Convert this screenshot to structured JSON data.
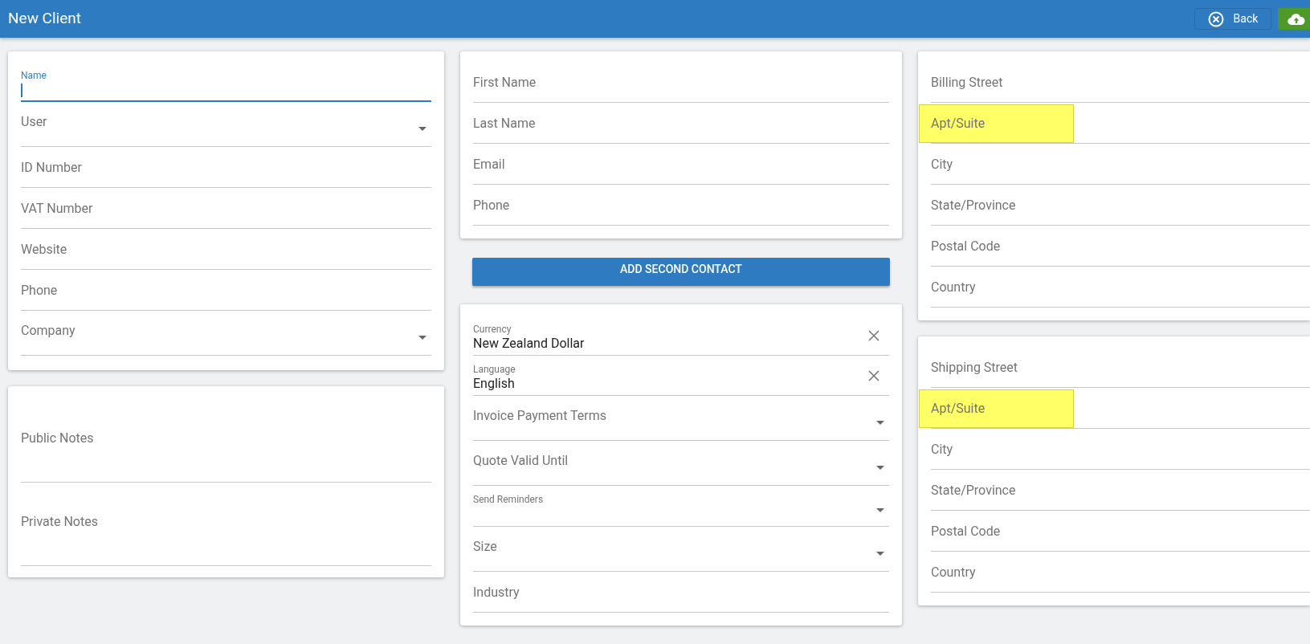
{
  "header": {
    "title": "New Client",
    "back_button": "Back"
  },
  "client_card": {
    "fields": [
      {
        "label": "Name",
        "kind": "text",
        "focused": true
      },
      {
        "label": "User",
        "kind": "select",
        "focused": false
      },
      {
        "label": "ID Number",
        "kind": "text",
        "focused": false
      },
      {
        "label": "VAT Number",
        "kind": "text",
        "focused": false
      },
      {
        "label": "Website",
        "kind": "text",
        "focused": false
      },
      {
        "label": "Phone",
        "kind": "text",
        "focused": false
      },
      {
        "label": "Company",
        "kind": "select",
        "focused": false
      }
    ]
  },
  "notes_card": {
    "fields": [
      {
        "label": "Public Notes",
        "kind": "textarea"
      },
      {
        "label": "Private Notes",
        "kind": "textarea"
      }
    ]
  },
  "contact_card": {
    "fields": [
      {
        "label": "First Name",
        "kind": "text"
      },
      {
        "label": "Last Name",
        "kind": "text"
      },
      {
        "label": "Email",
        "kind": "text"
      },
      {
        "label": "Phone",
        "kind": "text"
      }
    ]
  },
  "add_contact_button": "ADD SECOND CONTACT",
  "settings_card": {
    "fields": [
      {
        "label": "Currency",
        "kind": "clearable",
        "value": "New Zealand Dollar"
      },
      {
        "label": "Language",
        "kind": "clearable",
        "value": "English"
      },
      {
        "label": "Invoice Payment Terms",
        "kind": "select"
      },
      {
        "label": "Quote Valid Until",
        "kind": "select"
      },
      {
        "label": "Send Reminders",
        "kind": "select_floated"
      },
      {
        "label": "Size",
        "kind": "select"
      },
      {
        "label": "Industry",
        "kind": "text"
      }
    ]
  },
  "billing_card": {
    "fields": [
      {
        "label": "Billing Street",
        "highlighted": false
      },
      {
        "label": "Apt/Suite",
        "highlighted": true
      },
      {
        "label": "City",
        "highlighted": false
      },
      {
        "label": "State/Province",
        "highlighted": false
      },
      {
        "label": "Postal Code",
        "highlighted": false
      },
      {
        "label": "Country",
        "highlighted": false
      }
    ]
  },
  "shipping_card": {
    "fields": [
      {
        "label": "Shipping Street",
        "highlighted": false
      },
      {
        "label": "Apt/Suite",
        "highlighted": true
      },
      {
        "label": "City",
        "highlighted": false
      },
      {
        "label": "State/Province",
        "highlighted": false
      },
      {
        "label": "Postal Code",
        "highlighted": false
      },
      {
        "label": "Country",
        "highlighted": false
      }
    ]
  }
}
